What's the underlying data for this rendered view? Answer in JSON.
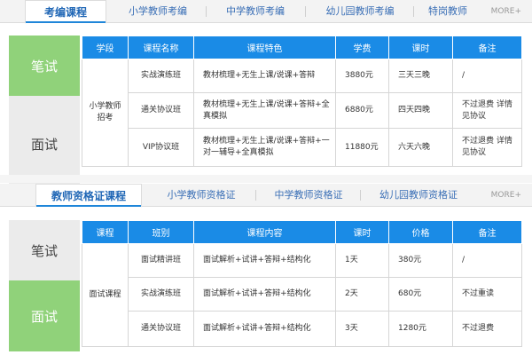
{
  "exam_courses": {
    "tabs": [
      {
        "label": "考编课程"
      },
      {
        "label": "小学教师考编"
      },
      {
        "label": "中学教师考编"
      },
      {
        "label": "幼儿园教师考编"
      },
      {
        "label": "特岗教师"
      }
    ],
    "more": "MORE+",
    "side": {
      "written": "笔试",
      "interview": "面试"
    },
    "headers": [
      "学段",
      "课程名称",
      "课程特色",
      "学费",
      "课时",
      "备注"
    ],
    "stage": "小学教师招考",
    "rows": [
      {
        "name": "实战演练班",
        "feature": "教材梳理+无生上课/说课+答辩",
        "fee": "3880元",
        "hours": "三天三晚",
        "note": "/"
      },
      {
        "name": "通关协议班",
        "feature": "教材梳理+无生上课/说课+答辩+全真模拟",
        "fee": "6880元",
        "hours": "四天四晚",
        "note": "不过退费 详情见协议"
      },
      {
        "name": "VIP协议班",
        "feature": "教材梳理+无生上课/说课+答辩+一对一辅导+全真模拟",
        "fee": "11880元",
        "hours": "六天六晚",
        "note": "不过退费 详情见协议"
      }
    ]
  },
  "cert_courses": {
    "tabs": [
      {
        "label": "教师资格证课程"
      },
      {
        "label": "小学教师资格证"
      },
      {
        "label": "中学教师资格证"
      },
      {
        "label": "幼儿园教师资格证"
      }
    ],
    "more": "MORE+",
    "side": {
      "written": "笔试",
      "interview": "面试"
    },
    "headers": [
      "课程",
      "班别",
      "课程内容",
      "课时",
      "价格",
      "备注"
    ],
    "course": "面试课程",
    "rows": [
      {
        "name": "面试精讲班",
        "content": "面试解析+试讲+答辩+结构化",
        "hours": "1天",
        "price": "380元",
        "note": "/"
      },
      {
        "name": "实战演练班",
        "content": "面试解析+试讲+答辩+结构化",
        "hours": "2天",
        "price": "680元",
        "note": "不过重读"
      },
      {
        "name": "通关协议班",
        "content": "面试解析+试讲+答辩+结构化",
        "hours": "3天",
        "price": "1280元",
        "note": "不过退费"
      }
    ]
  }
}
